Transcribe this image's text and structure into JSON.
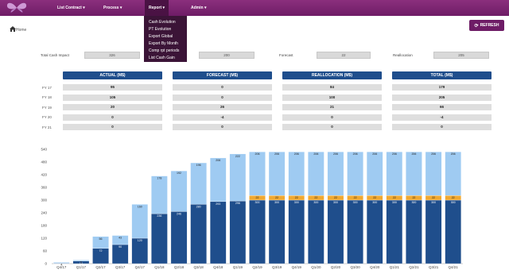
{
  "nav": {
    "items": [
      {
        "label": "List Contract ▾"
      },
      {
        "label": "Process ▾"
      },
      {
        "label": "Report ▾"
      },
      {
        "label": "Admin ▾"
      }
    ]
  },
  "report_menu": {
    "items": [
      {
        "label": "Cash Evolution"
      },
      {
        "label": "PT Evolution"
      },
      {
        "label": "Export Global"
      },
      {
        "label": "Export By Month"
      },
      {
        "label": "Comp rpt periods"
      },
      {
        "label": "List Cash Gain"
      }
    ]
  },
  "breadcrumb": {
    "home": "Home"
  },
  "refresh_label": "REFRESH",
  "summary": {
    "total_cash_impact": {
      "label": "Total Cash Impact",
      "value": "326"
    },
    "second": {
      "value": "200"
    },
    "forecast": {
      "label": "Forecast",
      "value": "22"
    },
    "reallocation": {
      "label": "Reallocation",
      "value": "205"
    }
  },
  "table": {
    "columns": [
      "ACTUAL (M$)",
      "FORECAST (M$)",
      "REALLOCATION (M$)",
      "TOTAL (M$)"
    ],
    "rows": [
      {
        "label": "FY 17",
        "values": [
          "95",
          "0",
          "84",
          "179"
        ]
      },
      {
        "label": "FY 18",
        "values": [
          "105",
          "0",
          "100",
          "205"
        ]
      },
      {
        "label": "FY 19",
        "values": [
          "20",
          "26",
          "21",
          "66"
        ]
      },
      {
        "label": "FY 20",
        "values": [
          "0",
          "-4",
          "0",
          "-4"
        ]
      },
      {
        "label": "FY 21",
        "values": [
          "0",
          "0",
          "0",
          "0"
        ]
      }
    ]
  },
  "colors": {
    "actual": "#1f4e8c",
    "forecast": "#f0a830",
    "reallocation": "#9fcbf2"
  },
  "chart_data": {
    "type": "bar",
    "stacked": true,
    "categories": [
      "Q4/17",
      "Q1/17",
      "Q2/17",
      "Q3/17",
      "Q4/17",
      "Q1/18",
      "Q2/18",
      "Q3/18",
      "Q4/18",
      "Q1/19",
      "Q2/19",
      "Q3/19",
      "Q4/19",
      "Q1/20",
      "Q2/20",
      "Q3/20",
      "Q4/20",
      "Q1/21",
      "Q2/21",
      "Q3/21",
      "Q4/21"
    ],
    "series": [
      {
        "values": [
          2,
          12,
          72,
          90,
          120,
          236,
          246,
          280,
          293,
          296,
          300,
          300,
          300,
          300,
          300,
          300,
          300,
          300,
          300,
          300,
          300
        ]
      },
      {
        "values": [
          0,
          0,
          0,
          0,
          0,
          0,
          0,
          0,
          0,
          0,
          22,
          22,
          22,
          22,
          22,
          22,
          22,
          22,
          22,
          22,
          22
        ]
      },
      {
        "values": [
          4,
          5,
          56,
          43,
          160,
          178,
          192,
          196,
          206,
          222,
          206,
          206,
          206,
          206,
          206,
          206,
          206,
          206,
          206,
          206,
          206
        ]
      }
    ],
    "ylim": [
      0,
      540
    ],
    "yticks": [
      0,
      60,
      120,
      180,
      240,
      300,
      360,
      420,
      480,
      540
    ],
    "grid": false
  }
}
